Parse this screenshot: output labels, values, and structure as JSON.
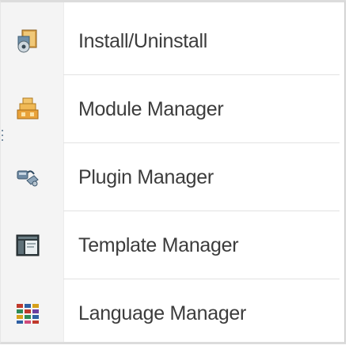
{
  "menu": {
    "items": [
      {
        "label": "Install/Uninstall",
        "icon": "install-box-icon"
      },
      {
        "label": "Module Manager",
        "icon": "module-stack-icon"
      },
      {
        "label": "Plugin Manager",
        "icon": "plugin-icon"
      },
      {
        "label": "Template Manager",
        "icon": "template-window-icon"
      },
      {
        "label": "Language Manager",
        "icon": "language-flags-icon"
      }
    ]
  },
  "colors": {
    "text": "#3c3c3c",
    "gutter": "#f4f4f4",
    "divider": "#e2e2e2",
    "border": "#d4d4d4"
  }
}
